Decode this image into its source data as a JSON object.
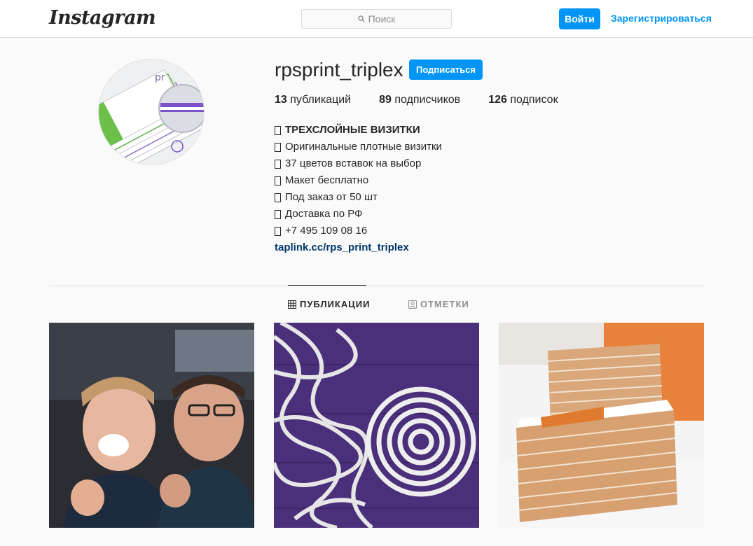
{
  "header": {
    "logo": "Instagram",
    "search_placeholder": "Поиск",
    "login_label": "Войти",
    "register_label": "Зарегистрироваться"
  },
  "profile": {
    "username": "rpsprint_triplex",
    "follow_label": "Подписаться",
    "stats": {
      "posts_count": "13",
      "posts_label": "публикаций",
      "followers_count": "89",
      "followers_label": "подписчиков",
      "following_count": "126",
      "following_label": "подписок"
    },
    "bio": [
      "ТРЕХСЛОЙНЫЕ ВИЗИТКИ",
      "Оригинальные плотные визитки",
      "37 цветов вставок на выбор",
      "Макет бесплатно",
      "Под заказ от 50 шт",
      "Доставка по РФ",
      "+7 495 109 08 16"
    ],
    "link": "taplink.cc/rps_print_triplex"
  },
  "tabs": {
    "posts_label": "ПУБЛИКАЦИИ",
    "tagged_label": "ОТМЕТКИ"
  },
  "colors": {
    "accent": "#0095f6",
    "link": "#00376b",
    "background": "#fafafa"
  },
  "icons": {
    "search": "search-icon",
    "grid": "grid-icon",
    "tagged": "tagged-person-icon"
  }
}
